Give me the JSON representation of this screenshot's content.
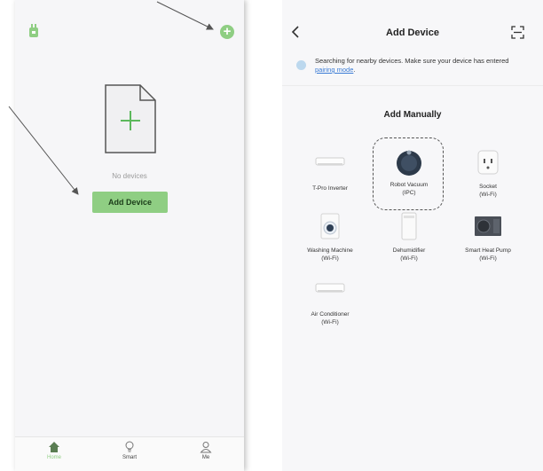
{
  "left": {
    "no_devices": "No devices",
    "add_device_button": "Add Device",
    "tabs": [
      {
        "label": "Home",
        "icon": "home-icon",
        "active": true
      },
      {
        "label": "Smart",
        "icon": "lightbulb-icon",
        "active": false
      },
      {
        "label": "Me",
        "icon": "person-icon",
        "active": false
      }
    ],
    "accent_color": "#8fce83"
  },
  "right": {
    "title": "Add Device",
    "hint_text": "Searching for nearby devices. Make sure your device has entered ",
    "hint_link": "pairing mode",
    "hint_end": ".",
    "section_title": "Add Manually",
    "devices": [
      {
        "name": "T-Pro Inverter",
        "sub": "",
        "icon": "inverter-icon"
      },
      {
        "name": "Robot Vacuum",
        "sub": "(IPC)",
        "icon": "robot-vacuum-icon",
        "highlighted": true
      },
      {
        "name": "Socket",
        "sub": "(Wi-Fi)",
        "icon": "socket-icon"
      },
      {
        "name": "Washing Machine",
        "sub": "(Wi-Fi)",
        "icon": "washing-machine-icon"
      },
      {
        "name": "Dehumidifier",
        "sub": "(Wi-Fi)",
        "icon": "dehumidifier-icon"
      },
      {
        "name": "Smart Heat Pump",
        "sub": "(Wi-Fi)",
        "icon": "heat-pump-icon"
      },
      {
        "name": "Air Conditioner",
        "sub": "(Wi-Fi)",
        "icon": "air-conditioner-icon"
      }
    ]
  }
}
